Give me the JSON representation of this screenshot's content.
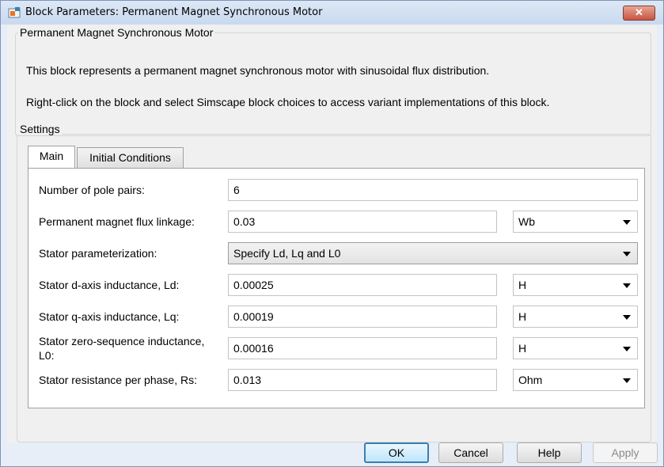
{
  "window": {
    "title": "Block Parameters: Permanent Magnet Synchronous Motor",
    "close_label": "✕"
  },
  "block": {
    "name": "Permanent Magnet Synchronous Motor",
    "description": "This block represents a permanent magnet synchronous motor with sinusoidal flux distribution.",
    "hint": "Right-click on the block and select Simscape block choices to access variant implementations of this block."
  },
  "settings": {
    "legend": "Settings",
    "tabs": [
      {
        "label": "Main",
        "active": true
      },
      {
        "label": "Initial Conditions",
        "active": false
      }
    ]
  },
  "params": {
    "pole_pairs": {
      "label": "Number of pole pairs:",
      "value": "6"
    },
    "flux": {
      "label": "Permanent magnet flux linkage:",
      "value": "0.03",
      "unit": "Wb"
    },
    "parameterization": {
      "label": "Stator parameterization:",
      "value": "Specify Ld, Lq and L0"
    },
    "ld": {
      "label": "Stator d-axis inductance, Ld:",
      "value": "0.00025",
      "unit": "H"
    },
    "lq": {
      "label": "Stator q-axis inductance, Lq:",
      "value": "0.00019",
      "unit": "H"
    },
    "l0": {
      "label_line1": "Stator zero-sequence inductance,",
      "label_line2": "L0:",
      "value": "0.00016",
      "unit": "H"
    },
    "rs": {
      "label": "Stator resistance per phase, Rs:",
      "value": "0.013",
      "unit": "Ohm"
    }
  },
  "buttons": {
    "ok": "OK",
    "cancel": "Cancel",
    "help": "Help",
    "apply": "Apply"
  }
}
